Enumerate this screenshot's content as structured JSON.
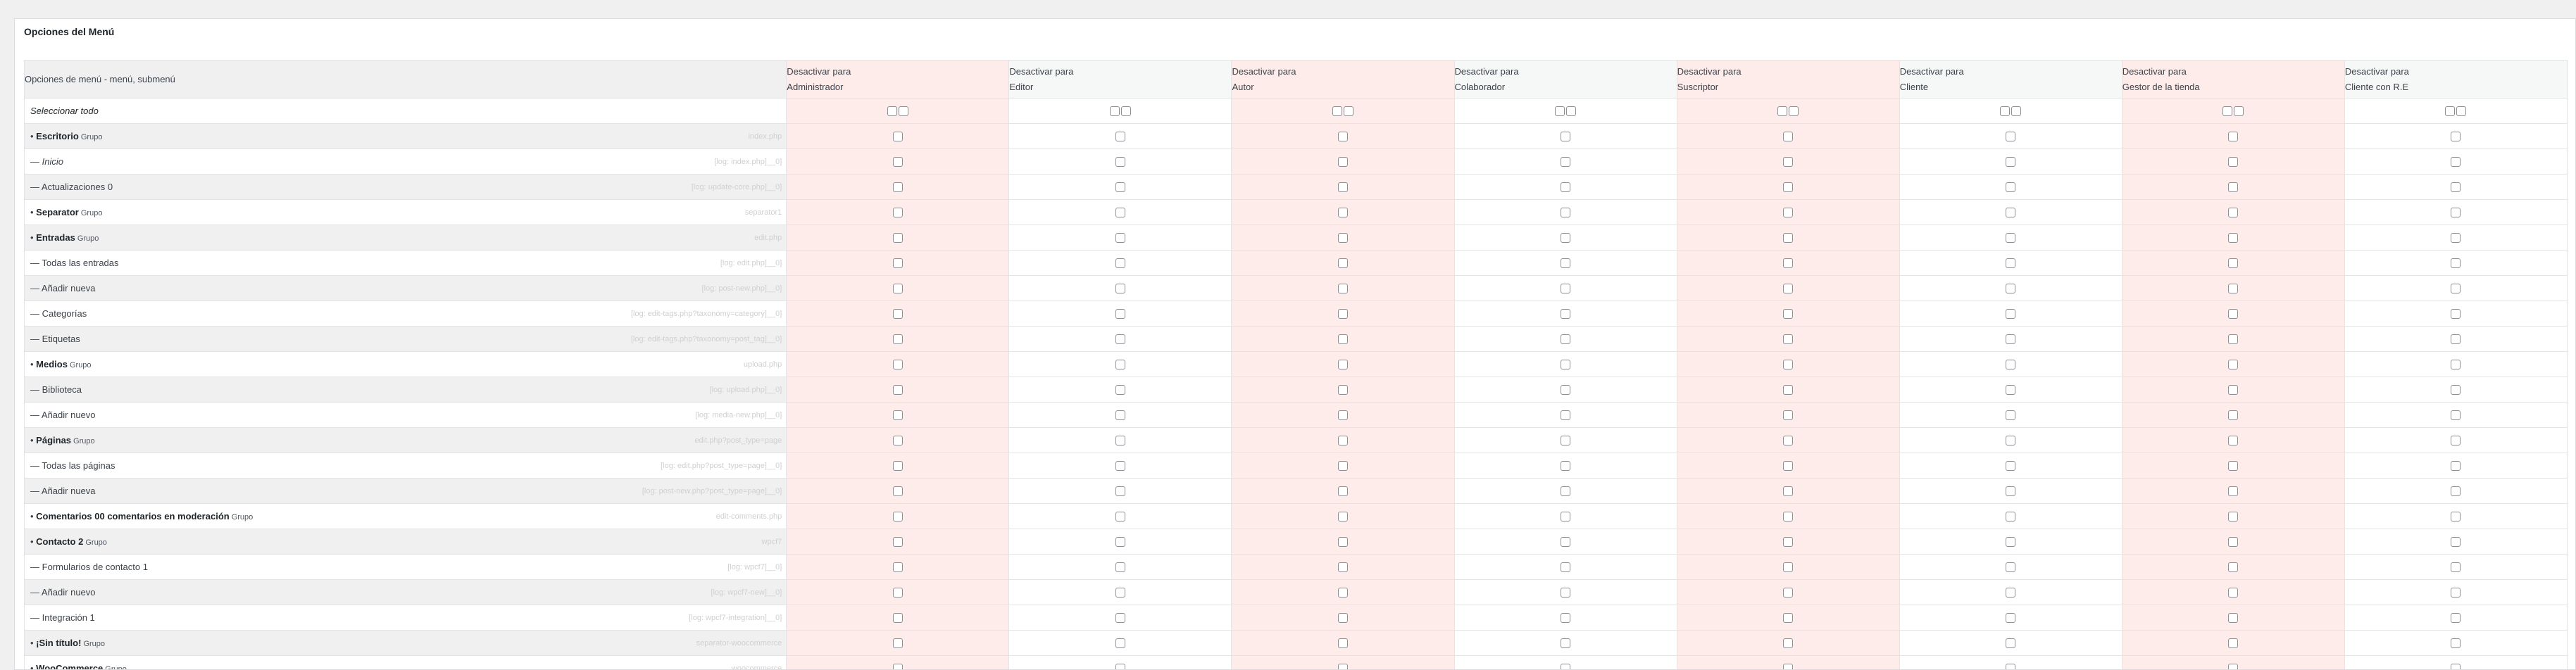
{
  "panel": {
    "title": "Opciones del Menú"
  },
  "table": {
    "first_header": "Opciones de menú - menú, submenú",
    "select_all_label": "Seleccionar todo",
    "roles": [
      {
        "line1": "Desactivar para",
        "line2": "Administrador",
        "highlight": true
      },
      {
        "line1": "Desactivar para",
        "line2": "Editor",
        "highlight": false
      },
      {
        "line1": "Desactivar para",
        "line2": "Autor",
        "highlight": true
      },
      {
        "line1": "Desactivar para",
        "line2": "Colaborador",
        "highlight": false
      },
      {
        "line1": "Desactivar para",
        "line2": "Suscriptor",
        "highlight": true
      },
      {
        "line1": "Desactivar para",
        "line2": "Cliente",
        "highlight": false
      },
      {
        "line1": "Desactivar para",
        "line2": "Gestor de la tienda",
        "highlight": true
      },
      {
        "line1": "Desactivar para",
        "line2": "Cliente con R.E",
        "highlight": false
      }
    ],
    "rows": [
      {
        "prefix": "• ",
        "label": "Escritorio",
        "group": "Grupo",
        "style": "bold",
        "slug": "index.php"
      },
      {
        "prefix": "— ",
        "label": "Inicio",
        "group": "",
        "style": "ital",
        "slug": "[log: index.php]__0]"
      },
      {
        "prefix": "— ",
        "label": "Actualizaciones 0",
        "group": "",
        "style": "",
        "slug": "[log: update-core.php]__0]"
      },
      {
        "prefix": "• ",
        "label": "Separator",
        "group": "Grupo",
        "style": "bold",
        "slug": "separator1"
      },
      {
        "prefix": "• ",
        "label": "Entradas",
        "group": "Grupo",
        "style": "bold",
        "slug": "edit.php"
      },
      {
        "prefix": "— ",
        "label": "Todas las entradas",
        "group": "",
        "style": "",
        "slug": "[log: edit.php]__0]"
      },
      {
        "prefix": "— ",
        "label": "Añadir nueva",
        "group": "",
        "style": "",
        "slug": "[log: post-new.php]__0]"
      },
      {
        "prefix": "— ",
        "label": "Categorías",
        "group": "",
        "style": "",
        "slug": "[log: edit-tags.php?taxonomy=category]__0]"
      },
      {
        "prefix": "— ",
        "label": "Etiquetas",
        "group": "",
        "style": "",
        "slug": "[log: edit-tags.php?taxonomy=post_tag]__0]"
      },
      {
        "prefix": "• ",
        "label": "Medios",
        "group": "Grupo",
        "style": "bold",
        "slug": "upload.php"
      },
      {
        "prefix": "— ",
        "label": "Biblioteca",
        "group": "",
        "style": "",
        "slug": "[log: upload.php]__0]"
      },
      {
        "prefix": "— ",
        "label": "Añadir nuevo",
        "group": "",
        "style": "",
        "slug": "[log: media-new.php]__0]"
      },
      {
        "prefix": "• ",
        "label": "Páginas",
        "group": "Grupo",
        "style": "bold",
        "slug": "edit.php?post_type=page"
      },
      {
        "prefix": "— ",
        "label": "Todas las páginas",
        "group": "",
        "style": "",
        "slug": "[log: edit.php?post_type=page]__0]"
      },
      {
        "prefix": "— ",
        "label": "Añadir nueva",
        "group": "",
        "style": "",
        "slug": "[log: post-new.php?post_type=page]__0]"
      },
      {
        "prefix": "• ",
        "label": "Comentarios 00 comentarios en moderación",
        "group": "Grupo",
        "style": "bold",
        "slug": "edit-comments.php"
      },
      {
        "prefix": "• ",
        "label": "Contacto 2",
        "group": "Grupo",
        "style": "bold",
        "slug": "wpcf7"
      },
      {
        "prefix": "— ",
        "label": "Formularios de contacto 1",
        "group": "",
        "style": "",
        "slug": "[log: wpcf7]__0]"
      },
      {
        "prefix": "— ",
        "label": "Añadir nuevo",
        "group": "",
        "style": "",
        "slug": "[log: wpcf7-new]__0]"
      },
      {
        "prefix": "— ",
        "label": "Integración 1",
        "group": "",
        "style": "",
        "slug": "[log: wpcf7-integration]__0]"
      },
      {
        "prefix": "• ",
        "label": "¡Sin título!",
        "group": "Grupo",
        "style": "bold",
        "slug": "separator-woocommerce"
      },
      {
        "prefix": "• ",
        "label": "WooCommerce",
        "group": "Grupo",
        "style": "bold",
        "slug": "woocommerce"
      }
    ]
  },
  "colors": {
    "highlight": "#fdecea",
    "alt_row": "#f0f0f1",
    "border": "#e2e4e7"
  }
}
